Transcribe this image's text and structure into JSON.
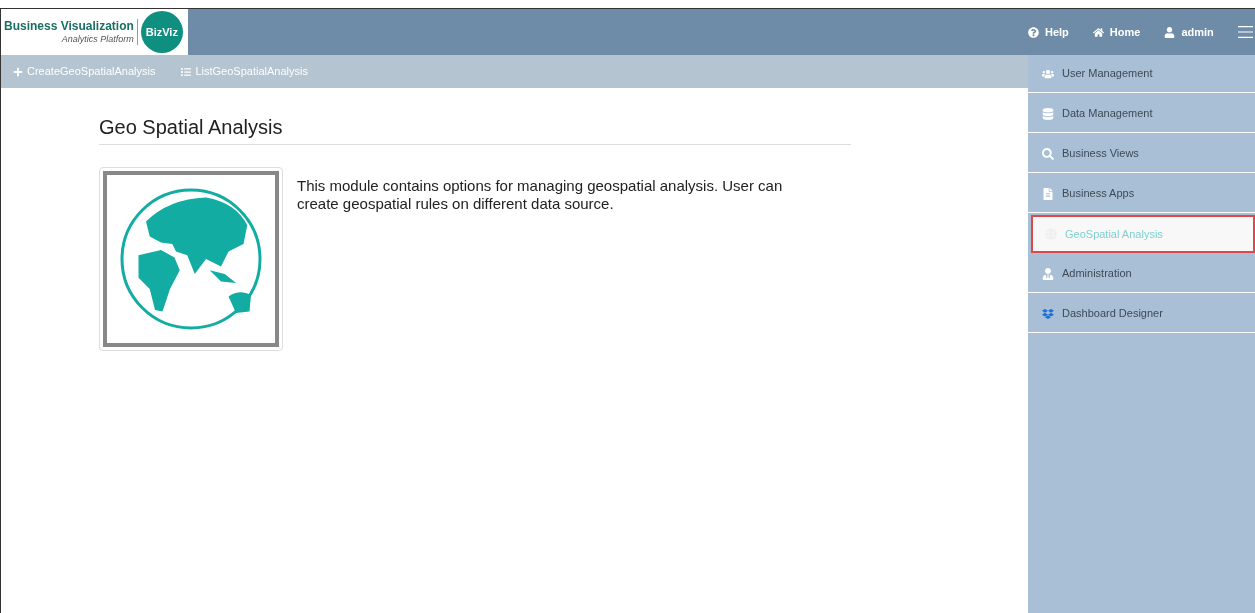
{
  "logo": {
    "title": "Business Visualization",
    "subtitle": "Analytics Platform",
    "badge": "BizViz"
  },
  "top_nav": [
    {
      "kind": "help",
      "label": "Help"
    },
    {
      "kind": "home",
      "label": "Home"
    },
    {
      "kind": "user",
      "label": "admin"
    }
  ],
  "sub_nav": [
    {
      "kind": "create",
      "label": "CreateGeoSpatialAnalysis"
    },
    {
      "kind": "list",
      "label": "ListGeoSpatialAnalysis"
    }
  ],
  "page": {
    "title": "Geo Spatial Analysis",
    "description": "This module contains options for managing geospatial analysis. User can create geospatial rules on different data source."
  },
  "sidebar": {
    "items": [
      {
        "kind": "users",
        "label": "User Management",
        "selected": false
      },
      {
        "kind": "data",
        "label": "Data Management",
        "selected": false
      },
      {
        "kind": "views",
        "label": "Business Views",
        "selected": false
      },
      {
        "kind": "apps",
        "label": "Business Apps",
        "selected": false
      },
      {
        "kind": "geo",
        "label": "GeoSpatial Analysis",
        "selected": true
      },
      {
        "kind": "admin",
        "label": "Administration",
        "selected": false
      },
      {
        "kind": "dashboard",
        "label": "Dashboard Designer",
        "selected": false
      }
    ]
  }
}
